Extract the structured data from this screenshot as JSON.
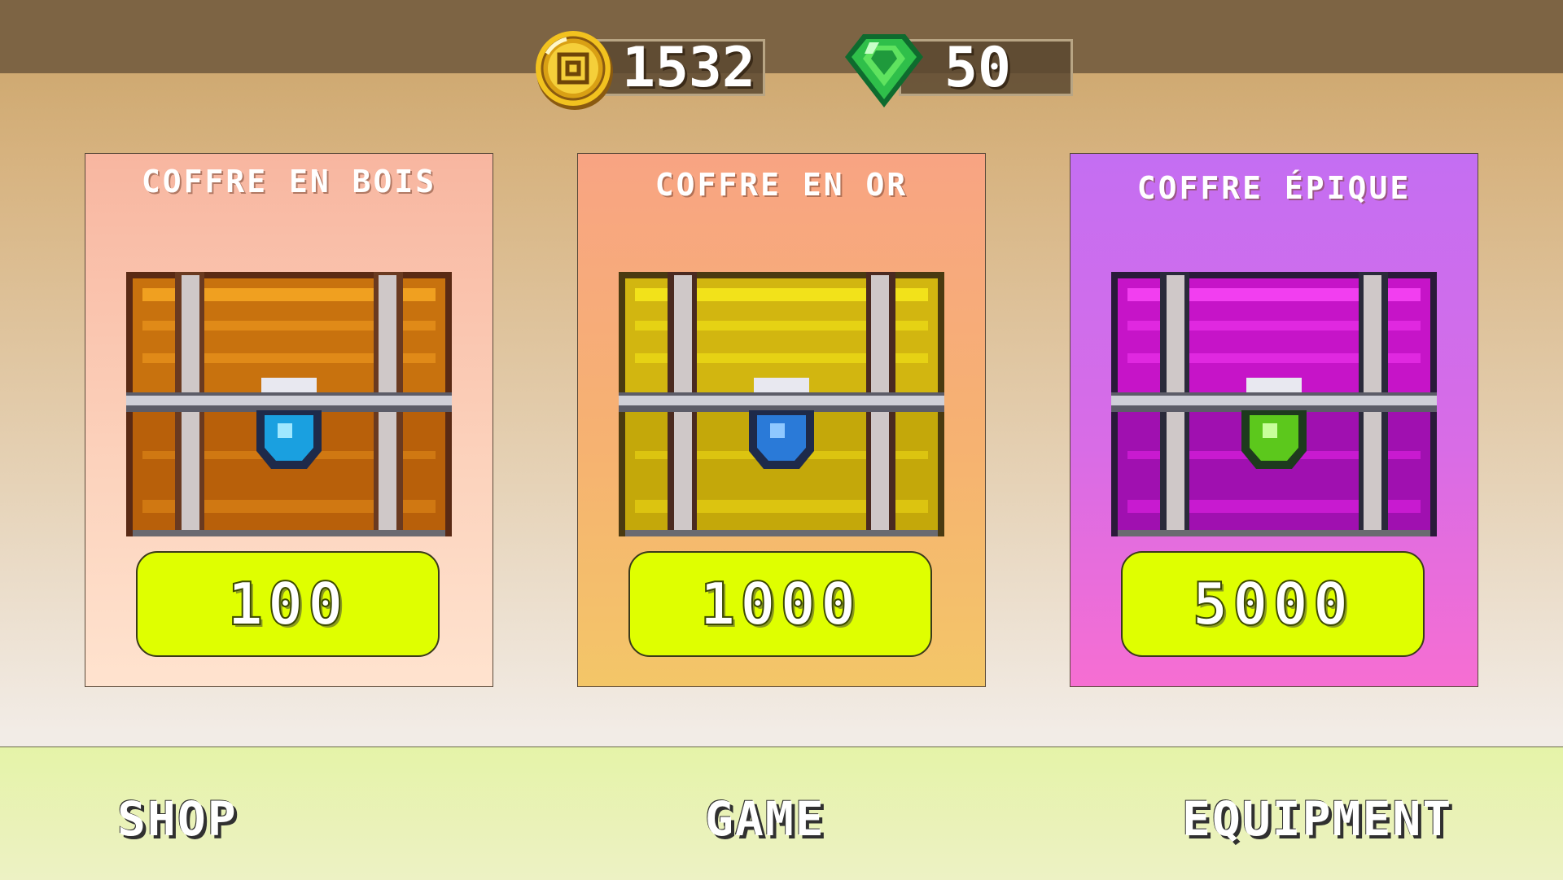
{
  "currencies": {
    "coins": {
      "value": "1532",
      "icon": "gold-coin-icon"
    },
    "gems": {
      "value": "50",
      "icon": "emerald-gem-icon"
    }
  },
  "chests": [
    {
      "title": "COFFRE EN BOIS",
      "price": "100",
      "color": "#d88a16"
    },
    {
      "title": "COFFRE EN OR",
      "price": "1000",
      "color": "#d6bd10"
    },
    {
      "title": "COFFRE ÉPIQUE",
      "price": "5000",
      "color": "#b412c4"
    }
  ],
  "nav": {
    "shop": "SHOP",
    "game": "GAME",
    "equipment": "EQUIPMENT"
  }
}
